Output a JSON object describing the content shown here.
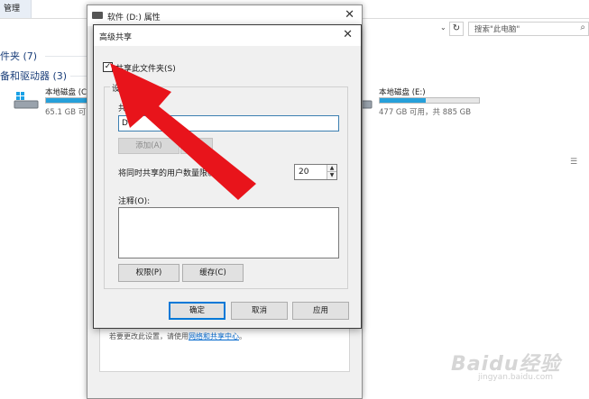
{
  "explorer": {
    "ribbon_tab": "管理",
    "search_placeholder": "搜索\"此电脑\"",
    "group_folders": "件夹 (7)",
    "group_devices": "备和驱动器 (3)",
    "drives": [
      {
        "name": "本地磁盘 (C",
        "free_text": "65.1 GB 可",
        "used_fraction": 0.7
      },
      {
        "name": "本地磁盘 (E:)",
        "free_text": "477 GB 可用，共 885 GB",
        "used_fraction": 0.46
      }
    ]
  },
  "props_window": {
    "title": "软件 (D:) 属性",
    "note_text": "若要更改此设置，请使用",
    "note_link": "网络和共享中心",
    "note_end": "。"
  },
  "dialog": {
    "title": "高级共享",
    "share_checkbox_label": "共享此文件夹(S)",
    "share_checked": true,
    "settings_legend": "设置",
    "share_name_label": "共享名(",
    "share_name_value": "D",
    "add_button": "添加(A)",
    "remove_button": "删除",
    "limit_label": "将同时共享的用户数量限制为",
    "limit_value": "20",
    "comment_label": "注释(O):",
    "permissions_button": "权限(P)",
    "cache_button": "缓存(C)",
    "ok_button": "确定",
    "cancel_button": "取消",
    "apply_button": "应用"
  },
  "watermark": {
    "logo": "Baidu经验",
    "url": "jingyan.baidu.com"
  },
  "colors": {
    "accent": "#0078d7",
    "drive_fill": "#26a0da",
    "arrow": "#e8141b"
  }
}
